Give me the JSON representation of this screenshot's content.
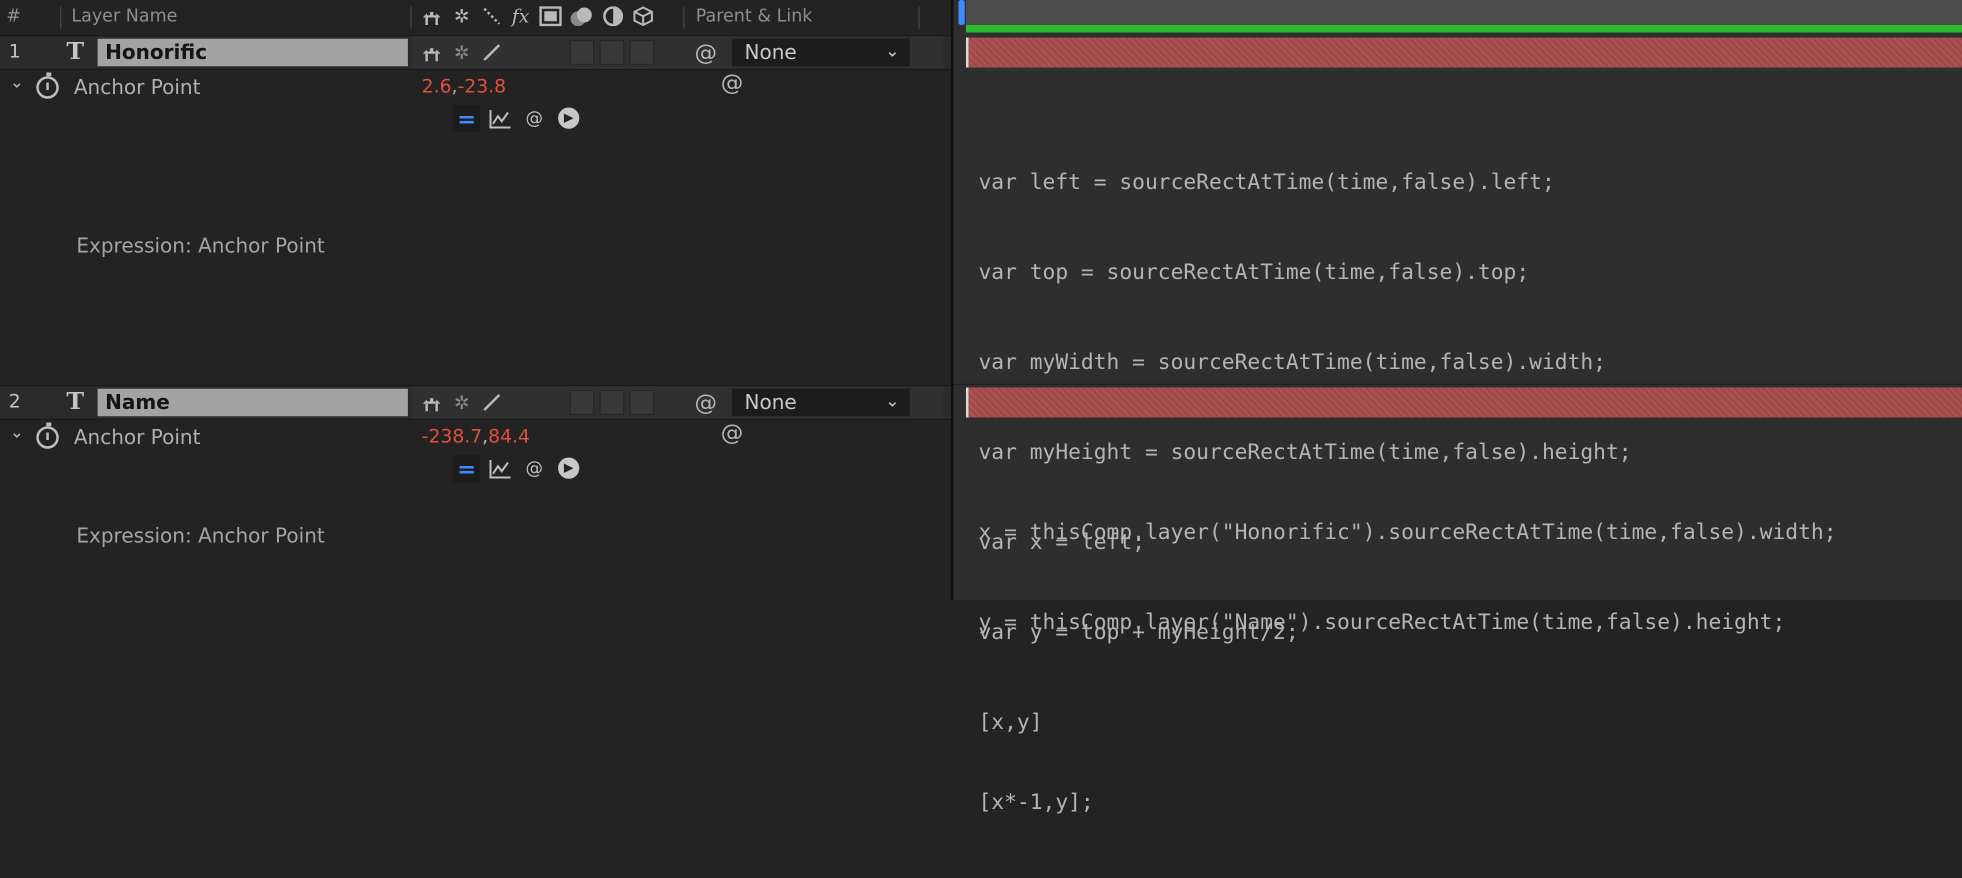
{
  "header": {
    "num_label": "#",
    "layer_name_label": "Layer Name",
    "fx_label": "fx",
    "parent_label": "Parent & Link"
  },
  "layers": [
    {
      "index": "1",
      "type_glyph": "T",
      "name": "Honorific",
      "parent": "None",
      "property": {
        "name": "Anchor Point",
        "value_x": "2.6",
        "value_sep": ",",
        "value_y": "-23.8"
      },
      "expression_label": "Expression: Anchor Point",
      "expression_lines": [
        "var left = sourceRectAtTime(time,false).left;",
        "var top = sourceRectAtTime(time,false).top;",
        "var myWidth = sourceRectAtTime(time,false).width;",
        "var myHeight = sourceRectAtTime(time,false).height;",
        "var x = left;",
        "var y = top + myHeight/2;",
        "[x,y]"
      ]
    },
    {
      "index": "2",
      "type_glyph": "T",
      "name": "Name",
      "parent": "None",
      "property": {
        "name": "Anchor Point",
        "value_x": "-238.7",
        "value_sep": ",",
        "value_y": "84.4"
      },
      "expression_label": "Expression: Anchor Point",
      "expression_lines": [
        "x = thisComp.layer(\"Honorific\").sourceRectAtTime(time,false).width;",
        "y = thisComp.layer(\"Name\").sourceRectAtTime(time,false).height;",
        "",
        "[x*-1,y];"
      ]
    }
  ],
  "colors": {
    "property_value": "#e0513c",
    "work_area": "#2bbd2f",
    "layer_bar": "#a84c4c",
    "time_indicator": "#3d8bff"
  },
  "icons": {
    "shy": "shy-icon",
    "collapse": "collapse-transform-icon",
    "quality": "quality-icon",
    "effects": "fx-icon",
    "frame_blend": "frame-blend-icon",
    "motion_blur": "motion-blur-icon",
    "adjustment": "adjustment-layer-icon",
    "three_d": "3d-layer-icon",
    "pickwhip": "pickwhip-spiral-icon",
    "stopwatch": "stopwatch-icon",
    "expr_enable": "expression-enable-icon",
    "expr_graph": "expression-graph-icon",
    "expr_language": "expression-language-menu-icon"
  }
}
